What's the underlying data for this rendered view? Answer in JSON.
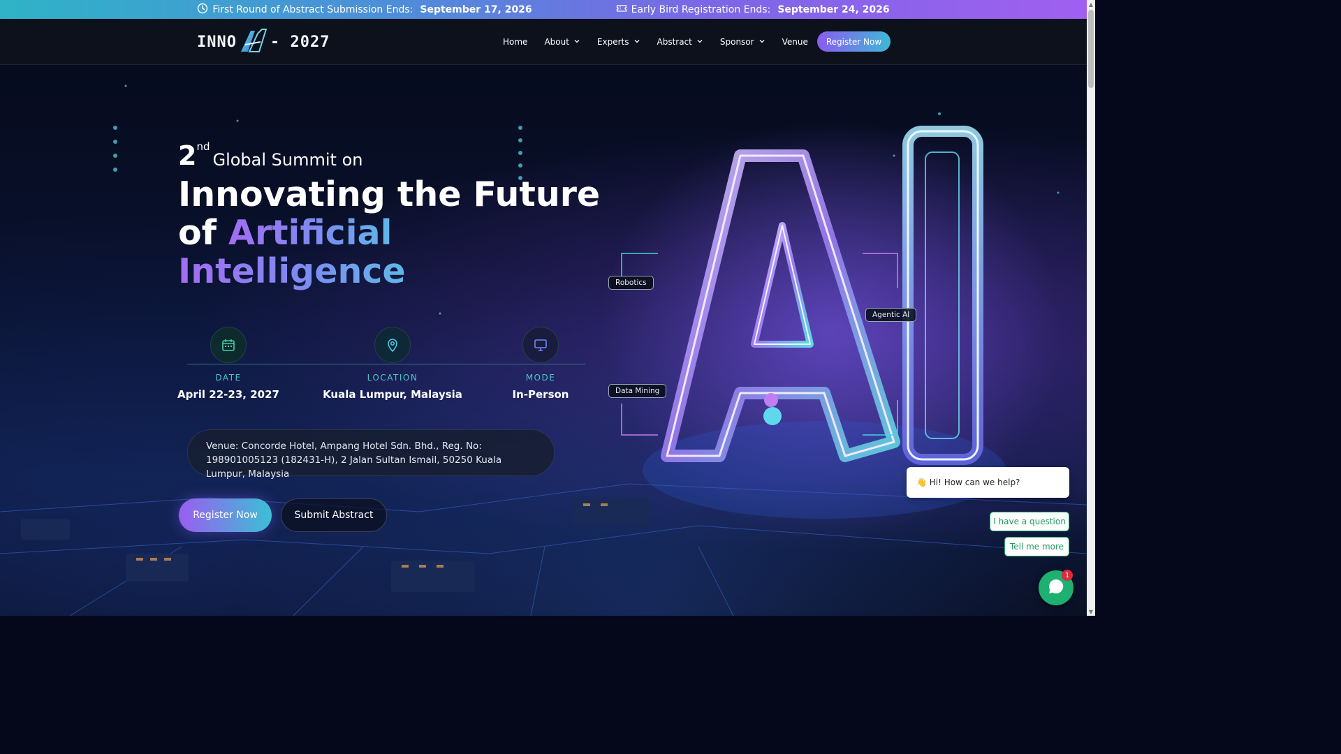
{
  "announcement": {
    "abstract_label": "First Round of Abstract Submission Ends:",
    "abstract_date": "September 17, 2026",
    "early_label": "Early Bird Registration Ends:",
    "early_date": "September 24, 2026",
    "abstract_icon": "clock-icon",
    "early_icon": "ticket-icon"
  },
  "logo": {
    "left": "INNO",
    "right": "- 2027",
    "mark": "ai-logo-mark"
  },
  "nav": {
    "items": [
      {
        "label": "Home",
        "dropdown": false
      },
      {
        "label": "About",
        "dropdown": true
      },
      {
        "label": "Experts",
        "dropdown": true
      },
      {
        "label": "Abstract",
        "dropdown": true
      },
      {
        "label": "Sponsor",
        "dropdown": true
      },
      {
        "label": "Venue",
        "dropdown": false
      }
    ],
    "register": "Register Now"
  },
  "hero": {
    "edition_num": "2",
    "edition_sup": "nd",
    "edition_text": "Global Summit on",
    "headline_plain_1": "Innovating the Future",
    "headline_plain_2": "of",
    "headline_accent_1": "Artificial",
    "headline_accent_2": "Intelligence",
    "info": [
      {
        "icon": "calendar-icon",
        "label": "DATE",
        "value": "April 22-23, 2027"
      },
      {
        "icon": "location-pin-icon",
        "label": "LOCATION",
        "value": "Kuala Lumpur, Malaysia"
      },
      {
        "icon": "monitor-icon",
        "label": "MODE",
        "value": "In-Person"
      }
    ],
    "venue": "Venue: Concorde Hotel, Ampang Hotel Sdn. Bhd., Reg. No: 198901005123 (182431-H), 2 Jalan Sultan Ismail, 50250 Kuala Lumpur, Malaysia",
    "register_btn": "Register Now",
    "abstract_btn": "Submit Abstract",
    "tags": [
      "Robotics",
      "Agentic AI",
      "Data Mining"
    ]
  },
  "chat": {
    "greeting": "👋 Hi! How can we help?",
    "options": [
      "I have a question",
      "Tell me more"
    ],
    "badge": "1"
  },
  "colors": {
    "accent_purple": "#9a5df0",
    "accent_cyan": "#3bc0d4",
    "teal_label": "#4bc8c4",
    "chat_green": "#1db070"
  }
}
